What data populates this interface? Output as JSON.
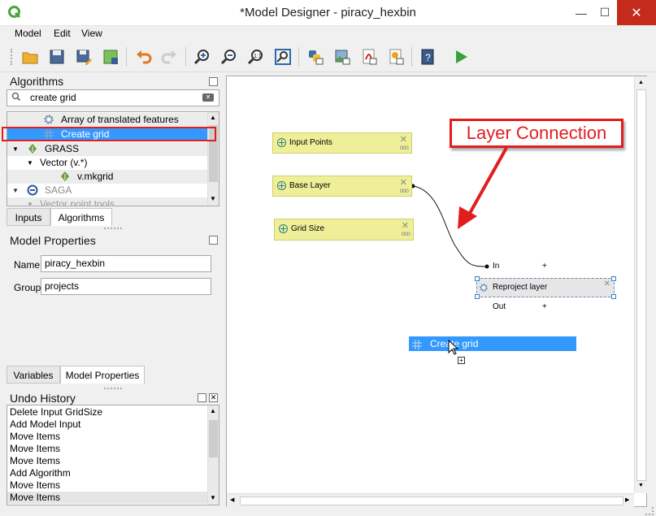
{
  "window": {
    "title": "*Model Designer - piracy_hexbin",
    "minimize": "—",
    "maximize": "☐",
    "close": "✕"
  },
  "menu": [
    {
      "label": "Model"
    },
    {
      "label": "Edit"
    },
    {
      "label": "View"
    }
  ],
  "algorithms_panel": {
    "title": "Algorithms",
    "search_value": "create grid",
    "tree": [
      {
        "label": "Array of translated features"
      },
      {
        "label": "Create grid"
      },
      {
        "label": "GRASS"
      },
      {
        "label": "Vector (v.*)"
      },
      {
        "label": "v.mkgrid"
      },
      {
        "label": "SAGA"
      },
      {
        "label": "Vector point tools"
      }
    ],
    "tabs": [
      {
        "label": "Inputs"
      },
      {
        "label": "Algorithms"
      }
    ]
  },
  "model_properties": {
    "title": "Model Properties",
    "name_label": "Name",
    "name_value": "piracy_hexbin",
    "group_label": "Group",
    "group_value": "projects",
    "tabs": [
      {
        "label": "Variables"
      },
      {
        "label": "Model Properties"
      }
    ]
  },
  "undo_history": {
    "title": "Undo History",
    "items": [
      "Delete Input GridSize",
      "Add Model Input",
      "Move Items",
      "Move Items",
      "Move Items",
      "Add Algorithm",
      "Move Items",
      "Move Items"
    ]
  },
  "canvas": {
    "inputs": [
      {
        "label": "Input Points"
      },
      {
        "label": "Base Layer"
      },
      {
        "label": "Grid Size"
      }
    ],
    "algorithm": {
      "label": "Reproject layer",
      "in_label": "In",
      "out_label": "Out",
      "plus": "+"
    },
    "drag_item": {
      "label": "Create grid"
    },
    "annotation": "Layer Connection"
  },
  "colors": {
    "selection": "#3399ff",
    "input_node": "#efef99",
    "callout": "#e21d1d"
  }
}
